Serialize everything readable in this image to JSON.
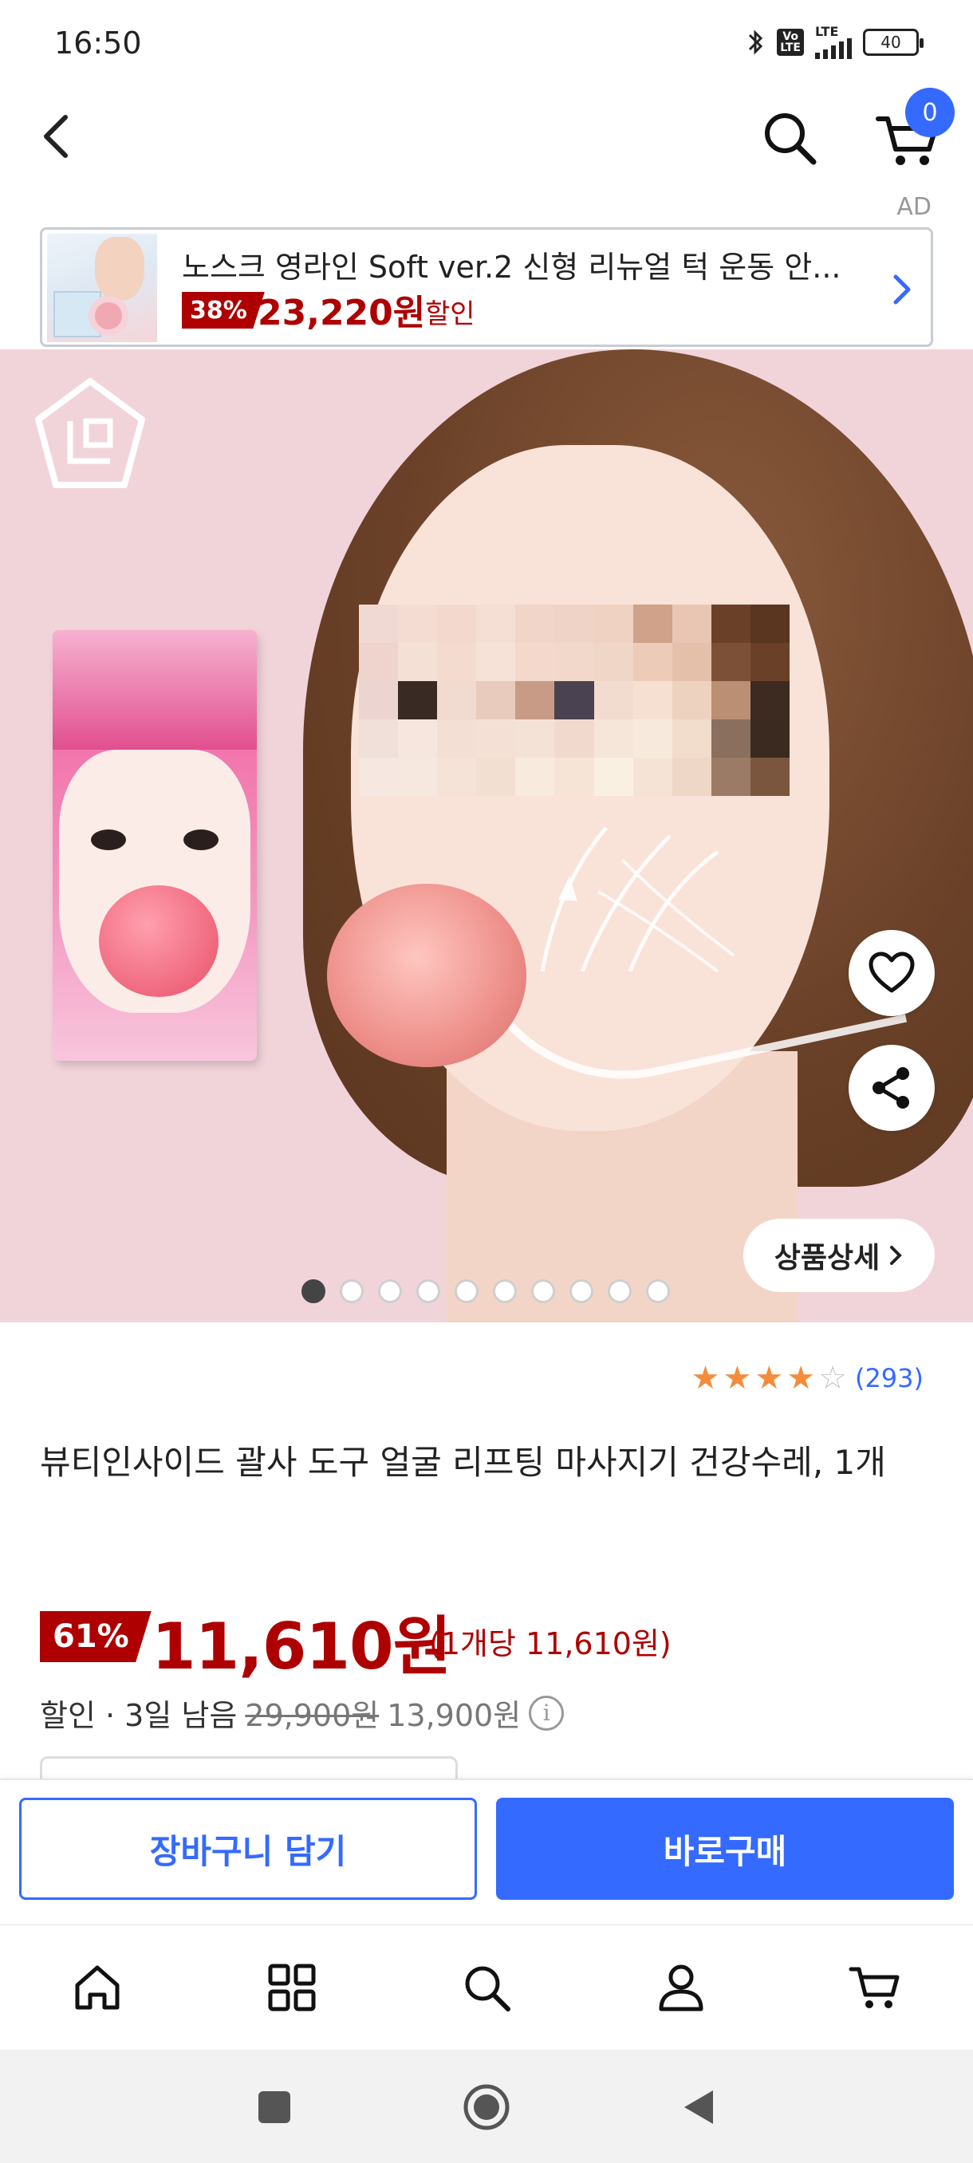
{
  "status_bar": {
    "time": "16:50",
    "bluetooth_icon": "bluetooth-icon",
    "volte_label": "Vo\nLTE",
    "lte_label": "LTE",
    "battery": "40"
  },
  "header": {
    "back_icon": "chevron-left-icon",
    "search_icon": "search-icon",
    "cart_icon": "cart-icon",
    "cart_count": "0"
  },
  "ad": {
    "label": "AD",
    "title": "노스크 영라인 Soft ver.2 신형 리뉴얼 턱 운동 안...",
    "discount": "38%",
    "price": "23,220원",
    "sale_label": "할인"
  },
  "product_image": {
    "detail_button": "상품상세",
    "page_count": 10,
    "current_page": 1,
    "wishlist_icon": "heart-icon",
    "share_icon": "share-icon"
  },
  "product": {
    "rating": 4,
    "rating_max": 5,
    "review_count": "(293)",
    "title": "뷰티인사이드 괄사 도구 얼굴 리프팅 마사지기 건강수레, 1개",
    "discount": "61%",
    "price": "11,610원",
    "unit_price": "(1개당 11,610원)",
    "sale_info": "할인 · 3일 남음",
    "original_price": "29,900원",
    "coupon_price": "13,900원"
  },
  "purchase_bar": {
    "add_to_cart": "장바구니 담기",
    "buy_now": "바로구매"
  },
  "bottom_nav": [
    {
      "icon": "home-icon"
    },
    {
      "icon": "category-icon"
    },
    {
      "icon": "search-icon"
    },
    {
      "icon": "user-icon"
    },
    {
      "icon": "cart-icon"
    }
  ],
  "colors": {
    "accent": "#346aff",
    "price_red": "#ae0000",
    "star": "#f48c3c",
    "image_background": "#f1d4da"
  }
}
